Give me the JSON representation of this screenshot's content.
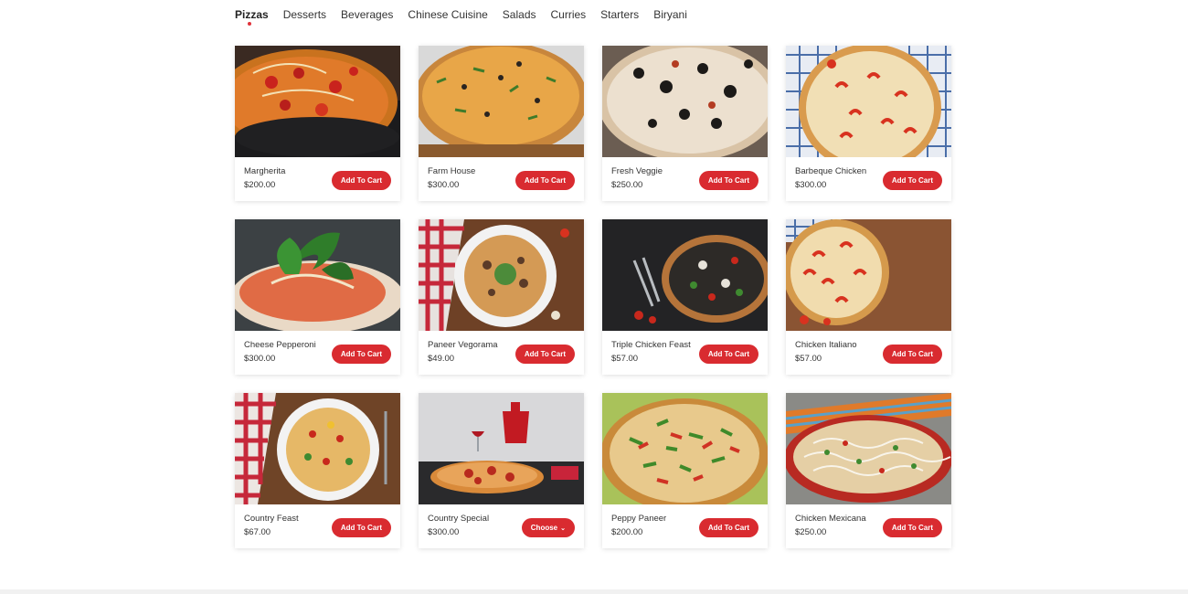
{
  "tabs": [
    {
      "label": "Pizzas",
      "active": true
    },
    {
      "label": "Desserts"
    },
    {
      "label": "Beverages"
    },
    {
      "label": "Chinese Cuisine"
    },
    {
      "label": "Salads"
    },
    {
      "label": "Curries"
    },
    {
      "label": "Starters"
    },
    {
      "label": "Biryani"
    }
  ],
  "colors": {
    "accent": "#d92b30"
  },
  "products": [
    {
      "name": "Margherita",
      "price": "$200.00",
      "button": "Add To Cart"
    },
    {
      "name": "Farm House",
      "price": "$300.00",
      "button": "Add To Cart"
    },
    {
      "name": "Fresh Veggie",
      "price": "$250.00",
      "button": "Add To Cart"
    },
    {
      "name": "Barbeque Chicken",
      "price": "$300.00",
      "button": "Add To Cart"
    },
    {
      "name": "Cheese Pepperoni",
      "price": "$300.00",
      "button": "Add To Cart"
    },
    {
      "name": "Paneer Vegorama",
      "price": "$49.00",
      "button": "Add To Cart"
    },
    {
      "name": "Triple Chicken Feast",
      "price": "$57.00",
      "button": "Add To Cart"
    },
    {
      "name": "Chicken Italiano",
      "price": "$57.00",
      "button": "Add To Cart"
    },
    {
      "name": "Country Feast",
      "price": "$67.00",
      "button": "Add To Cart"
    },
    {
      "name": "Country Special",
      "price": "$300.00",
      "button": "Choose",
      "dropdown": true
    },
    {
      "name": "Peppy Paneer",
      "price": "$200.00",
      "button": "Add To Cart"
    },
    {
      "name": "Chicken Mexicana",
      "price": "$250.00",
      "button": "Add To Cart"
    }
  ]
}
